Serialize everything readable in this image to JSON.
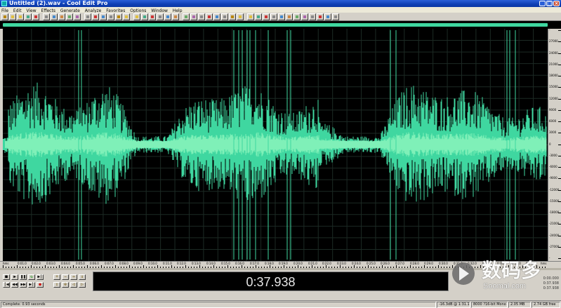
{
  "window": {
    "title": "Untitled (2).wav - Cool Edit Pro"
  },
  "menu": [
    "File",
    "Edit",
    "View",
    "Effects",
    "Generate",
    "Analyze",
    "Favorites",
    "Options",
    "Window",
    "Help"
  ],
  "colors": {
    "waveform": "#3fd7a0",
    "waveform_bright": "#7ff0b8",
    "background": "#000000",
    "chrome": "#d4d0c8"
  },
  "amplitude_ruler": {
    "labels": [
      "-",
      "27000",
      "24000",
      "21000",
      "18000",
      "15000",
      "12000",
      "9000",
      "6000",
      "3000",
      "0",
      "-3000",
      "-6000",
      "-9000",
      "-12000",
      "-15000",
      "-18000",
      "-21000",
      "-24000",
      "-27000",
      "-"
    ]
  },
  "time_ruler": {
    "labels": [
      "hms",
      "0:01.0",
      "0:02.0",
      "0:03.0",
      "0:04.0",
      "0:05.0",
      "0:06.0",
      "0:07.0",
      "0:08.0",
      "0:09.0",
      "0:10.0",
      "0:11.0",
      "0:12.0",
      "0:13.0",
      "0:14.0",
      "0:15.0",
      "0:16.0",
      "0:17.0",
      "0:18.0",
      "0:19.0",
      "0:20.0",
      "0:21.0",
      "0:22.0",
      "0:23.0",
      "0:24.0",
      "0:25.0",
      "0:26.0",
      "0:27.0",
      "0:28.0",
      "0:29.0",
      "0:30.0",
      "0:31.0",
      "0:32.0",
      "0:33.0",
      "0:34.0",
      "0:35.0",
      "0:36.0",
      "hms"
    ]
  },
  "transport": {
    "time_display": "0:37.938",
    "buttons": [
      "stop",
      "play",
      "pause",
      "play-looped",
      "play-to-end",
      "go-start",
      "rewind",
      "fast-forward",
      "go-end",
      "record"
    ],
    "zoom_buttons": [
      "zoom-in-horizontal",
      "zoom-out-horizontal",
      "zoom-out-full",
      "zoom-in-vertical",
      "zoom-out-vertical",
      "zoom-selection",
      "zoom-left",
      "zoom-right"
    ],
    "selection_view": {
      "row1": "0:00.000",
      "row2": "0:37.938",
      "row3": "0:37.938"
    }
  },
  "status_bar": {
    "left": "Complete: 0.93 seconds",
    "db": "-16.3dB @ 1:31.195",
    "format": "8000 ?16-bit Mono",
    "size": "2.05 MB",
    "free": "2.74 GB free"
  },
  "watermark": {
    "text_cn": "数码多",
    "text_en": "Soomal.com"
  }
}
